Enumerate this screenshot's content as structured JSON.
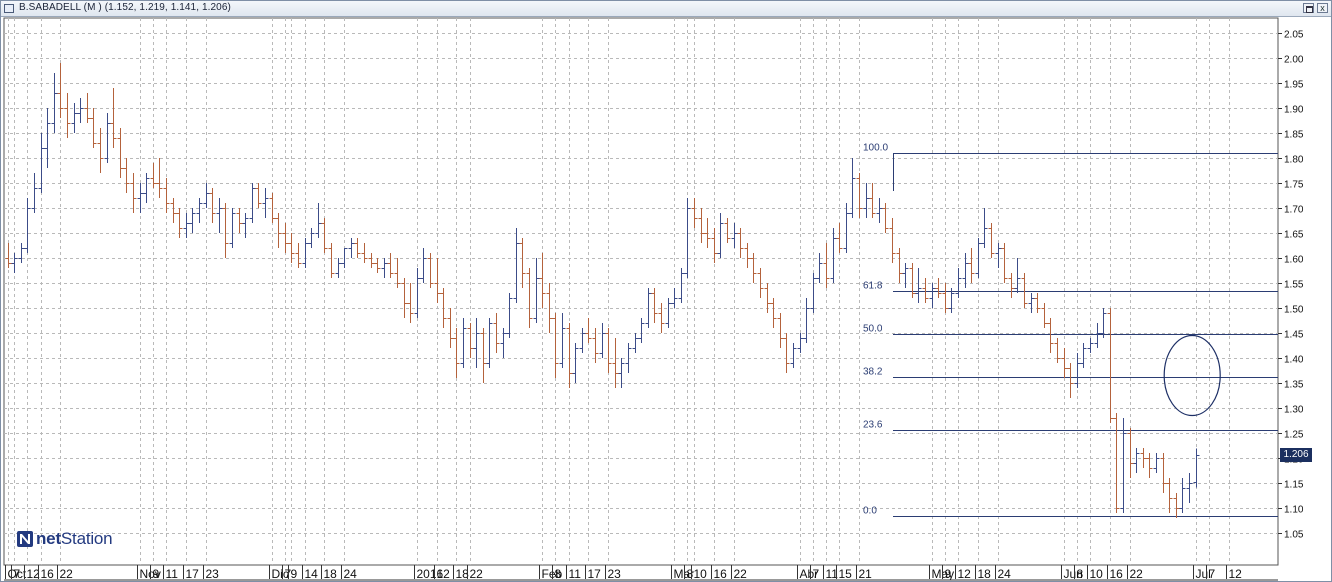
{
  "window": {
    "title": "B.SABADELL (M ) (1.152, 1.219, 1.141, 1.206)",
    "close_glyph": "x"
  },
  "price_tag": "1.206",
  "logo": {
    "bold": "net",
    "normal": "Station",
    "icon": "netstation-n-logo-icon"
  },
  "colors": {
    "up": "#3c4c88",
    "down": "#b4623c",
    "grid": "#b9b9b9",
    "fib": "#2b3d73",
    "ellipse": "#1d2f66",
    "price_tag_bg": "#1b2f5f"
  },
  "chart_data": {
    "type": "ohlc",
    "instrument": "B.SABADELL (M )",
    "last_bar": {
      "open": 1.152,
      "high": 1.219,
      "low": 1.141,
      "close": 1.206
    },
    "ylim": [
      1.0,
      2.09
    ],
    "y_ticks": [
      "2.05",
      "2.00",
      "1.95",
      "1.90",
      "1.85",
      "1.80",
      "1.75",
      "1.70",
      "1.65",
      "1.60",
      "1.55",
      "1.50",
      "1.45",
      "1.40",
      "1.35",
      "1.30",
      "1.25",
      "1.20",
      "1.15",
      "1.10",
      "1.05"
    ],
    "grid": true,
    "x_labels": [
      "Oct",
      "7",
      "12",
      "16",
      "22",
      "Nov",
      "9",
      "11",
      "17",
      "23",
      "Dic",
      "7",
      "9",
      "14",
      "18",
      "24",
      "2016",
      "12",
      "18",
      "22",
      "Feb",
      "8",
      "11",
      "17",
      "23",
      "Mar",
      "8",
      "10",
      "16",
      "22",
      "Abr",
      "7",
      "11",
      "15",
      "21",
      "May",
      "9",
      "12",
      "18",
      "24",
      "Jun",
      "8",
      "10",
      "16",
      "22",
      "Jul",
      "7",
      "12"
    ],
    "x_label_slots": [
      0,
      1,
      3,
      5,
      8,
      20,
      22,
      24,
      27,
      30,
      40,
      42,
      43,
      45,
      48,
      51,
      62,
      65,
      68,
      70,
      81,
      83,
      85,
      88,
      91,
      101,
      103,
      104,
      107,
      110,
      120,
      122,
      124,
      126,
      129,
      140,
      142,
      144,
      147,
      150,
      160,
      162,
      164,
      167,
      170,
      180,
      182,
      185
    ],
    "ohlc": [
      [
        1.6,
        1.63,
        1.58,
        1.59
      ],
      [
        1.59,
        1.61,
        1.57,
        1.6
      ],
      [
        1.6,
        1.63,
        1.59,
        1.62
      ],
      [
        1.62,
        1.72,
        1.61,
        1.7
      ],
      [
        1.7,
        1.77,
        1.69,
        1.74
      ],
      [
        1.74,
        1.85,
        1.73,
        1.82
      ],
      [
        1.82,
        1.9,
        1.78,
        1.87
      ],
      [
        1.87,
        1.97,
        1.85,
        1.93
      ],
      [
        1.93,
        1.99,
        1.88,
        1.9
      ],
      [
        1.9,
        1.93,
        1.84,
        1.87
      ],
      [
        1.87,
        1.91,
        1.85,
        1.89
      ],
      [
        1.89,
        1.92,
        1.87,
        1.9
      ],
      [
        1.9,
        1.93,
        1.87,
        1.88
      ],
      [
        1.88,
        1.9,
        1.82,
        1.83
      ],
      [
        1.83,
        1.86,
        1.77,
        1.8
      ],
      [
        1.8,
        1.89,
        1.79,
        1.87
      ],
      [
        1.87,
        1.94,
        1.82,
        1.84
      ],
      [
        1.84,
        1.86,
        1.76,
        1.78
      ],
      [
        1.78,
        1.8,
        1.73,
        1.75
      ],
      [
        1.75,
        1.77,
        1.69,
        1.72
      ],
      [
        1.72,
        1.75,
        1.69,
        1.73
      ],
      [
        1.73,
        1.77,
        1.71,
        1.76
      ],
      [
        1.76,
        1.79,
        1.74,
        1.75
      ],
      [
        1.75,
        1.8,
        1.72,
        1.74
      ],
      [
        1.74,
        1.76,
        1.69,
        1.71
      ],
      [
        1.71,
        1.72,
        1.67,
        1.69
      ],
      [
        1.69,
        1.7,
        1.64,
        1.66
      ],
      [
        1.66,
        1.69,
        1.64,
        1.67
      ],
      [
        1.67,
        1.7,
        1.65,
        1.69
      ],
      [
        1.69,
        1.72,
        1.67,
        1.71
      ],
      [
        1.71,
        1.75,
        1.7,
        1.73
      ],
      [
        1.73,
        1.74,
        1.67,
        1.69
      ],
      [
        1.69,
        1.72,
        1.65,
        1.7
      ],
      [
        1.7,
        1.71,
        1.6,
        1.63
      ],
      [
        1.63,
        1.7,
        1.62,
        1.69
      ],
      [
        1.69,
        1.7,
        1.65,
        1.67
      ],
      [
        1.67,
        1.69,
        1.64,
        1.68
      ],
      [
        1.68,
        1.75,
        1.67,
        1.74
      ],
      [
        1.74,
        1.75,
        1.7,
        1.71
      ],
      [
        1.71,
        1.74,
        1.68,
        1.72
      ],
      [
        1.72,
        1.73,
        1.67,
        1.68
      ],
      [
        1.68,
        1.69,
        1.62,
        1.65
      ],
      [
        1.65,
        1.67,
        1.61,
        1.63
      ],
      [
        1.63,
        1.65,
        1.59,
        1.61
      ],
      [
        1.61,
        1.63,
        1.58,
        1.59
      ],
      [
        1.59,
        1.64,
        1.58,
        1.63
      ],
      [
        1.63,
        1.66,
        1.62,
        1.65
      ],
      [
        1.65,
        1.71,
        1.64,
        1.67
      ],
      [
        1.67,
        1.68,
        1.61,
        1.62
      ],
      [
        1.62,
        1.63,
        1.56,
        1.57
      ],
      [
        1.57,
        1.6,
        1.56,
        1.59
      ],
      [
        1.59,
        1.62,
        1.58,
        1.62
      ],
      [
        1.62,
        1.64,
        1.6,
        1.63
      ],
      [
        1.63,
        1.64,
        1.6,
        1.61
      ],
      [
        1.61,
        1.63,
        1.59,
        1.6
      ],
      [
        1.6,
        1.61,
        1.58,
        1.59
      ],
      [
        1.59,
        1.6,
        1.57,
        1.58
      ],
      [
        1.58,
        1.6,
        1.56,
        1.59
      ],
      [
        1.59,
        1.61,
        1.56,
        1.57
      ],
      [
        1.57,
        1.6,
        1.54,
        1.55
      ],
      [
        1.55,
        1.56,
        1.48,
        1.51
      ],
      [
        1.51,
        1.55,
        1.47,
        1.49
      ],
      [
        1.49,
        1.58,
        1.48,
        1.56
      ],
      [
        1.56,
        1.62,
        1.55,
        1.6
      ],
      [
        1.6,
        1.61,
        1.54,
        1.55
      ],
      [
        1.55,
        1.6,
        1.51,
        1.53
      ],
      [
        1.53,
        1.54,
        1.46,
        1.48
      ],
      [
        1.48,
        1.5,
        1.42,
        1.44
      ],
      [
        1.44,
        1.46,
        1.36,
        1.39
      ],
      [
        1.39,
        1.48,
        1.38,
        1.46
      ],
      [
        1.46,
        1.47,
        1.4,
        1.42
      ],
      [
        1.42,
        1.48,
        1.38,
        1.45
      ],
      [
        1.45,
        1.46,
        1.35,
        1.39
      ],
      [
        1.39,
        1.48,
        1.38,
        1.47
      ],
      [
        1.47,
        1.49,
        1.41,
        1.43
      ],
      [
        1.43,
        1.46,
        1.4,
        1.45
      ],
      [
        1.45,
        1.53,
        1.44,
        1.52
      ],
      [
        1.52,
        1.66,
        1.51,
        1.63
      ],
      [
        1.63,
        1.64,
        1.54,
        1.57
      ],
      [
        1.57,
        1.58,
        1.46,
        1.48
      ],
      [
        1.48,
        1.6,
        1.47,
        1.56
      ],
      [
        1.56,
        1.61,
        1.5,
        1.53
      ],
      [
        1.53,
        1.55,
        1.45,
        1.48
      ],
      [
        1.48,
        1.49,
        1.36,
        1.39
      ],
      [
        1.39,
        1.49,
        1.38,
        1.46
      ],
      [
        1.46,
        1.47,
        1.34,
        1.37
      ],
      [
        1.37,
        1.43,
        1.35,
        1.42
      ],
      [
        1.42,
        1.46,
        1.41,
        1.45
      ],
      [
        1.45,
        1.48,
        1.43,
        1.44
      ],
      [
        1.44,
        1.46,
        1.39,
        1.41
      ],
      [
        1.41,
        1.47,
        1.4,
        1.45
      ],
      [
        1.45,
        1.46,
        1.37,
        1.39
      ],
      [
        1.39,
        1.44,
        1.34,
        1.37
      ],
      [
        1.37,
        1.4,
        1.34,
        1.39
      ],
      [
        1.39,
        1.43,
        1.37,
        1.42
      ],
      [
        1.42,
        1.45,
        1.41,
        1.44
      ],
      [
        1.44,
        1.48,
        1.43,
        1.47
      ],
      [
        1.47,
        1.54,
        1.46,
        1.53
      ],
      [
        1.53,
        1.54,
        1.47,
        1.49
      ],
      [
        1.49,
        1.51,
        1.45,
        1.47
      ],
      [
        1.47,
        1.52,
        1.46,
        1.51
      ],
      [
        1.51,
        1.54,
        1.5,
        1.52
      ],
      [
        1.52,
        1.58,
        1.51,
        1.57
      ],
      [
        1.57,
        1.72,
        1.56,
        1.7
      ],
      [
        1.7,
        1.72,
        1.66,
        1.68
      ],
      [
        1.68,
        1.7,
        1.63,
        1.65
      ],
      [
        1.65,
        1.68,
        1.62,
        1.64
      ],
      [
        1.64,
        1.66,
        1.59,
        1.61
      ],
      [
        1.61,
        1.69,
        1.6,
        1.67
      ],
      [
        1.67,
        1.68,
        1.63,
        1.64
      ],
      [
        1.64,
        1.67,
        1.62,
        1.65
      ],
      [
        1.65,
        1.66,
        1.6,
        1.62
      ],
      [
        1.62,
        1.63,
        1.58,
        1.6
      ],
      [
        1.6,
        1.61,
        1.55,
        1.57
      ],
      [
        1.57,
        1.58,
        1.52,
        1.54
      ],
      [
        1.54,
        1.55,
        1.49,
        1.51
      ],
      [
        1.51,
        1.52,
        1.46,
        1.48
      ],
      [
        1.48,
        1.49,
        1.42,
        1.44
      ],
      [
        1.44,
        1.45,
        1.37,
        1.39
      ],
      [
        1.39,
        1.43,
        1.38,
        1.42
      ],
      [
        1.42,
        1.45,
        1.41,
        1.44
      ],
      [
        1.44,
        1.52,
        1.43,
        1.5
      ],
      [
        1.5,
        1.57,
        1.49,
        1.56
      ],
      [
        1.56,
        1.61,
        1.55,
        1.59
      ],
      [
        1.59,
        1.63,
        1.54,
        1.56
      ],
      [
        1.56,
        1.66,
        1.55,
        1.64
      ],
      [
        1.64,
        1.67,
        1.61,
        1.62
      ],
      [
        1.62,
        1.71,
        1.61,
        1.69
      ],
      [
        1.69,
        1.8,
        1.68,
        1.76
      ],
      [
        1.76,
        1.77,
        1.68,
        1.7
      ],
      [
        1.7,
        1.75,
        1.68,
        1.72
      ],
      [
        1.72,
        1.75,
        1.68,
        1.69
      ],
      [
        1.69,
        1.72,
        1.67,
        1.7
      ],
      [
        1.7,
        1.71,
        1.65,
        1.66
      ],
      [
        1.66,
        1.68,
        1.59,
        1.61
      ],
      [
        1.61,
        1.62,
        1.55,
        1.57
      ],
      [
        1.57,
        1.59,
        1.54,
        1.58
      ],
      [
        1.58,
        1.59,
        1.52,
        1.53
      ],
      [
        1.53,
        1.58,
        1.51,
        1.54
      ],
      [
        1.54,
        1.56,
        1.51,
        1.52
      ],
      [
        1.52,
        1.55,
        1.5,
        1.54
      ],
      [
        1.54,
        1.56,
        1.52,
        1.53
      ],
      [
        1.53,
        1.55,
        1.49,
        1.5
      ],
      [
        1.5,
        1.54,
        1.49,
        1.53
      ],
      [
        1.53,
        1.58,
        1.52,
        1.56
      ],
      [
        1.56,
        1.61,
        1.54,
        1.59
      ],
      [
        1.59,
        1.62,
        1.55,
        1.57
      ],
      [
        1.57,
        1.64,
        1.56,
        1.63
      ],
      [
        1.63,
        1.7,
        1.62,
        1.66
      ],
      [
        1.66,
        1.67,
        1.6,
        1.61
      ],
      [
        1.61,
        1.63,
        1.58,
        1.62
      ],
      [
        1.62,
        1.63,
        1.55,
        1.56
      ],
      [
        1.56,
        1.57,
        1.52,
        1.54
      ],
      [
        1.54,
        1.6,
        1.53,
        1.56
      ],
      [
        1.56,
        1.57,
        1.5,
        1.51
      ],
      [
        1.51,
        1.53,
        1.49,
        1.52
      ],
      [
        1.52,
        1.53,
        1.49,
        1.5
      ],
      [
        1.5,
        1.51,
        1.46,
        1.47
      ],
      [
        1.47,
        1.48,
        1.41,
        1.43
      ],
      [
        1.43,
        1.44,
        1.39,
        1.4
      ],
      [
        1.4,
        1.42,
        1.36,
        1.38
      ],
      [
        1.38,
        1.39,
        1.32,
        1.35
      ],
      [
        1.35,
        1.41,
        1.34,
        1.39
      ],
      [
        1.39,
        1.43,
        1.38,
        1.42
      ],
      [
        1.42,
        1.44,
        1.41,
        1.43
      ],
      [
        1.43,
        1.47,
        1.42,
        1.45
      ],
      [
        1.45,
        1.5,
        1.44,
        1.49
      ],
      [
        1.49,
        1.5,
        1.27,
        1.28
      ],
      [
        1.28,
        1.29,
        1.09,
        1.1
      ],
      [
        1.1,
        1.28,
        1.09,
        1.25
      ],
      [
        1.25,
        1.26,
        1.16,
        1.19
      ],
      [
        1.19,
        1.22,
        1.17,
        1.21
      ],
      [
        1.21,
        1.22,
        1.18,
        1.2
      ],
      [
        1.2,
        1.21,
        1.16,
        1.18
      ],
      [
        1.18,
        1.21,
        1.17,
        1.2
      ],
      [
        1.2,
        1.21,
        1.13,
        1.15
      ],
      [
        1.15,
        1.16,
        1.09,
        1.12
      ],
      [
        1.12,
        1.13,
        1.08,
        1.1
      ],
      [
        1.1,
        1.16,
        1.09,
        1.14
      ],
      [
        1.14,
        1.17,
        1.11,
        1.15
      ],
      [
        1.152,
        1.219,
        1.141,
        1.206
      ]
    ],
    "fibonacci": {
      "high": 1.81,
      "low": 1.084,
      "levels": [
        {
          "label": "100.0",
          "value": 1.81
        },
        {
          "label": "61.8",
          "value": 1.533
        },
        {
          "label": "50.0",
          "value": 1.447
        },
        {
          "label": "38.2",
          "value": 1.361
        },
        {
          "label": "23.6",
          "value": 1.255
        },
        {
          "label": "0.0",
          "value": 1.084
        }
      ]
    },
    "annotations": [
      {
        "type": "ellipse",
        "bar_center": 179.5,
        "price_top": 1.445,
        "price_bottom": 1.285
      }
    ]
  }
}
